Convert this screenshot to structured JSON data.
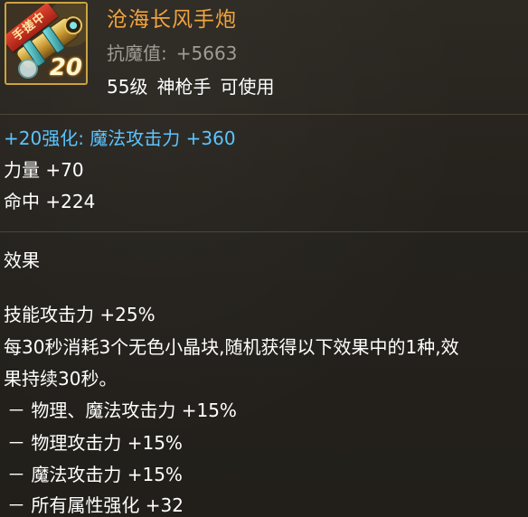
{
  "item": {
    "name": "沧海长风手炮",
    "icon": "hand-cannon-icon",
    "ribbon": "手搓中",
    "level_badge": "20",
    "anti_magic_label": "抗魔值:",
    "anti_magic_value": "+5663",
    "level_req": "55级",
    "class_req": "神枪手",
    "usable": "可使用"
  },
  "stats": {
    "reinforce": "+20强化: 魔法攻击力 +360",
    "strength": "力量 +70",
    "hit": "命中 +224"
  },
  "effect": {
    "title": "效果",
    "lines": [
      "技能攻击力 +25%",
      "每30秒消耗3个无色小晶块,随机获得以下效果中的1种,效",
      "果持续30秒。",
      "－ 物理、魔法攻击力 +15%",
      "－ 物理攻击力 +15%",
      "－ 魔法攻击力 +15%",
      "－ 所有属性强化 +32"
    ]
  },
  "colors": {
    "name": "#f0a23a",
    "reinforce": "#57c3ff",
    "frame": "#c9a23c"
  }
}
